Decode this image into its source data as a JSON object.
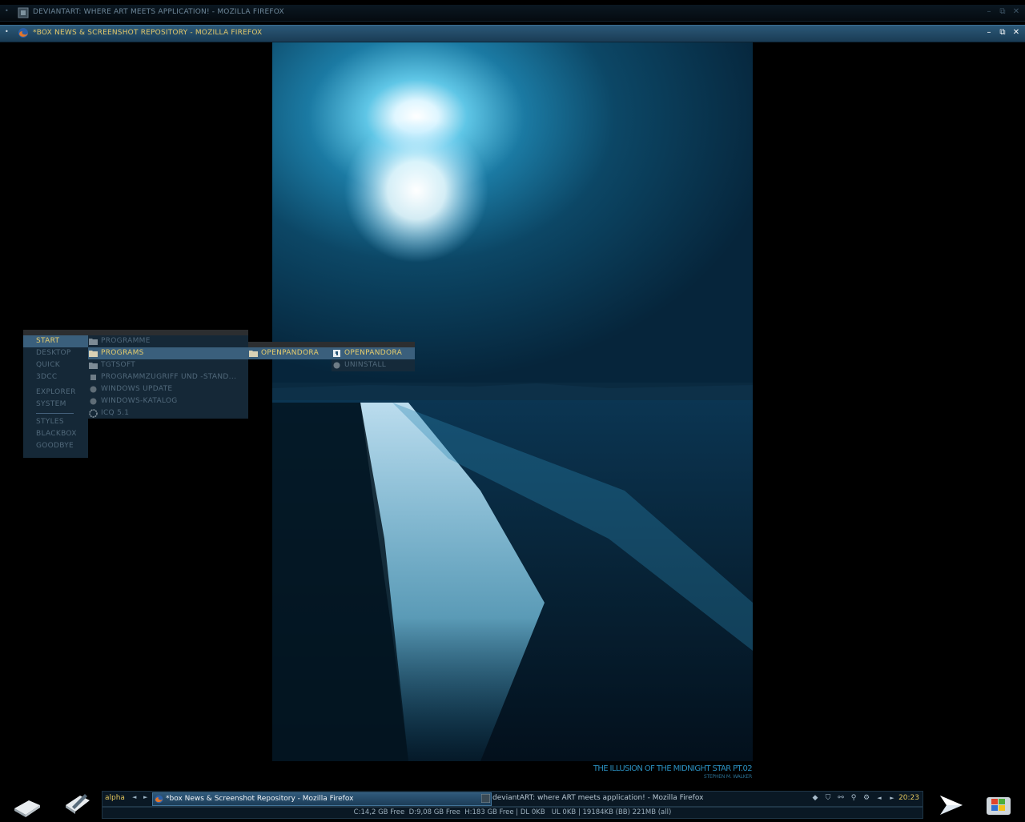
{
  "windows": {
    "inactive": {
      "title": "DEVIANTART: WHERE ART MEETS APPLICATION! - MOZILLA FIREFOX"
    },
    "active": {
      "title": "*BOX NEWS & SCREENSHOT REPOSITORY - MOZILLA FIREFOX"
    }
  },
  "window_buttons": {
    "minimize": "–",
    "maximize": "⧉",
    "close": "✕"
  },
  "wallpaper": {
    "caption_title": "THE ILLUSION OF THE MIDNIGHT STAR Pt.02",
    "caption_author": "STEPHEN M. WALKER"
  },
  "root_menu": {
    "items": [
      {
        "label": "START"
      },
      {
        "label": "DESKTOP"
      },
      {
        "label": "QUICK"
      },
      {
        "label": "3DCC"
      },
      {
        "label": "EXPLORER"
      },
      {
        "label": "SYSTEM"
      },
      {
        "label": "STYLES"
      },
      {
        "label": "BLACKBOX"
      },
      {
        "label": "GOODBYE"
      }
    ]
  },
  "start_menu": {
    "items": [
      {
        "label": "PROGRAMME",
        "icon": "folder-icon"
      },
      {
        "label": "PROGRAMS",
        "icon": "folder-icon"
      },
      {
        "label": "TGTSOFT",
        "icon": "folder-icon"
      },
      {
        "label": "PROGRAMMZUGRIFF UND -STAND...",
        "icon": "shortcut-icon"
      },
      {
        "label": "WINDOWS UPDATE",
        "icon": "windows-update-icon"
      },
      {
        "label": "WINDOWS-KATALOG",
        "icon": "windows-catalog-icon"
      },
      {
        "label": "ICQ 5.1",
        "icon": "icq-flower-icon"
      }
    ]
  },
  "programs_menu": {
    "items": [
      {
        "label": "OPENPANDORA",
        "icon": "folder-icon"
      }
    ]
  },
  "openpandora_menu": {
    "items": [
      {
        "label": "OPENPANDORA",
        "icon": "openpandora-app-icon"
      },
      {
        "label": "UNINSTALL",
        "icon": "uninstall-icon"
      }
    ]
  },
  "taskbar": {
    "workspace": "alpha",
    "tasks": [
      {
        "label": "*box News & Screenshot Repository - Mozilla Firefox",
        "state": "active"
      },
      {
        "label": "deviantART: where ART meets application! - Mozilla Firefox",
        "state": "inactive"
      }
    ],
    "clock": "20:23",
    "tray_icons": [
      "arrow-icon",
      "shield-icon",
      "network-icon",
      "search-tool-icon",
      "settings-icon"
    ]
  },
  "statusbar": {
    "text": "C:14,2 GB Free  D:9,08 GB Free  H:183 GB Free | DL 0KB   UL 0KB | 19184KB (BB) 221MB (all)"
  },
  "colors": {
    "accent_yellow": "#e0c45c",
    "active_bar": "#2b5877",
    "menu_bg": "#162a3a",
    "menu_selected": "#3a5f7c"
  }
}
